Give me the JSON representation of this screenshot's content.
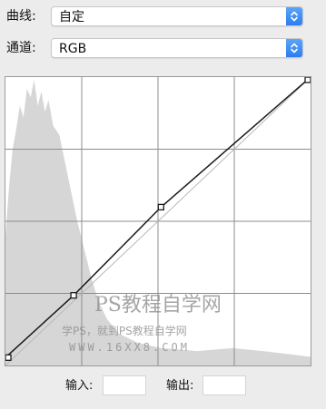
{
  "curves_preset": {
    "label": "曲线:",
    "value": "自定"
  },
  "channel": {
    "label": "通道:",
    "value": "RGB"
  },
  "curve_graph": {
    "histogram_color": "#d6d6d6",
    "grid_color": "#8c8c8c",
    "curve_color": "#1a1a1a",
    "baseline_color": "#b8b8b8",
    "grid_divisions": 4,
    "control_points": [
      {
        "input": 0,
        "output": 7
      },
      {
        "input": 57,
        "output": 62
      },
      {
        "input": 130,
        "output": 140
      },
      {
        "input": 255,
        "output": 255
      }
    ]
  },
  "watermark": {
    "line1": "PS教程自学网",
    "line2": "学PS，就到PS教程自学网",
    "line3": "WWW.16XX8.COM"
  },
  "io": {
    "input_label": "输入:",
    "input_value": "",
    "output_label": "输出:",
    "output_value": ""
  },
  "accent_color": "#2d7cf0"
}
